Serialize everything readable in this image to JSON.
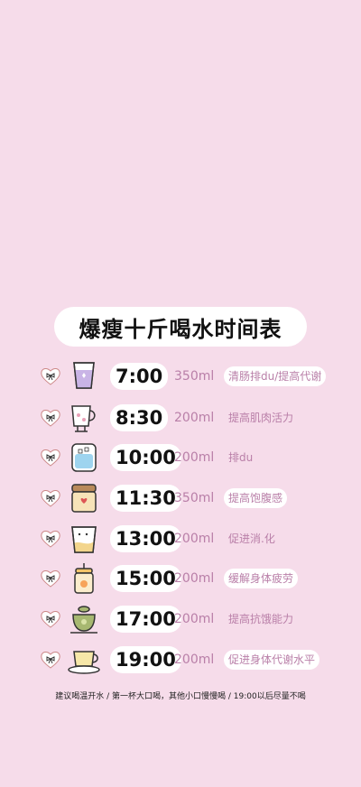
{
  "title": "爆瘦十斤喝水时间表",
  "schedule": [
    {
      "time": "7:00",
      "amount": "350ml",
      "desc": "清肠排du/提高代谢",
      "icon": "glass-icon"
    },
    {
      "time": "8:30",
      "amount": "200ml",
      "desc": "提高肌肉活力",
      "icon": "mug-icon"
    },
    {
      "time": "10:00",
      "amount": "200ml",
      "desc": "排du",
      "icon": "water-cup-icon"
    },
    {
      "time": "11:30",
      "amount": "350ml",
      "desc": "提高饱腹感",
      "icon": "jar-icon"
    },
    {
      "time": "13:00",
      "amount": "200ml",
      "desc": "促进消.化",
      "icon": "cup-icon"
    },
    {
      "time": "15:00",
      "amount": "200ml",
      "desc": "缓解身体疲劳",
      "icon": "juice-icon"
    },
    {
      "time": "17:00",
      "amount": "200ml",
      "desc": "提高抗饿能力",
      "icon": "teapot-icon"
    },
    {
      "time": "19:00",
      "amount": "200ml",
      "desc": "促进身体代谢水平",
      "icon": "teacup-icon"
    }
  ],
  "footer": "建议喝温开水 / 第一杯大口喝，其他小口慢慢喝 / 19:00以后尽量不喝"
}
